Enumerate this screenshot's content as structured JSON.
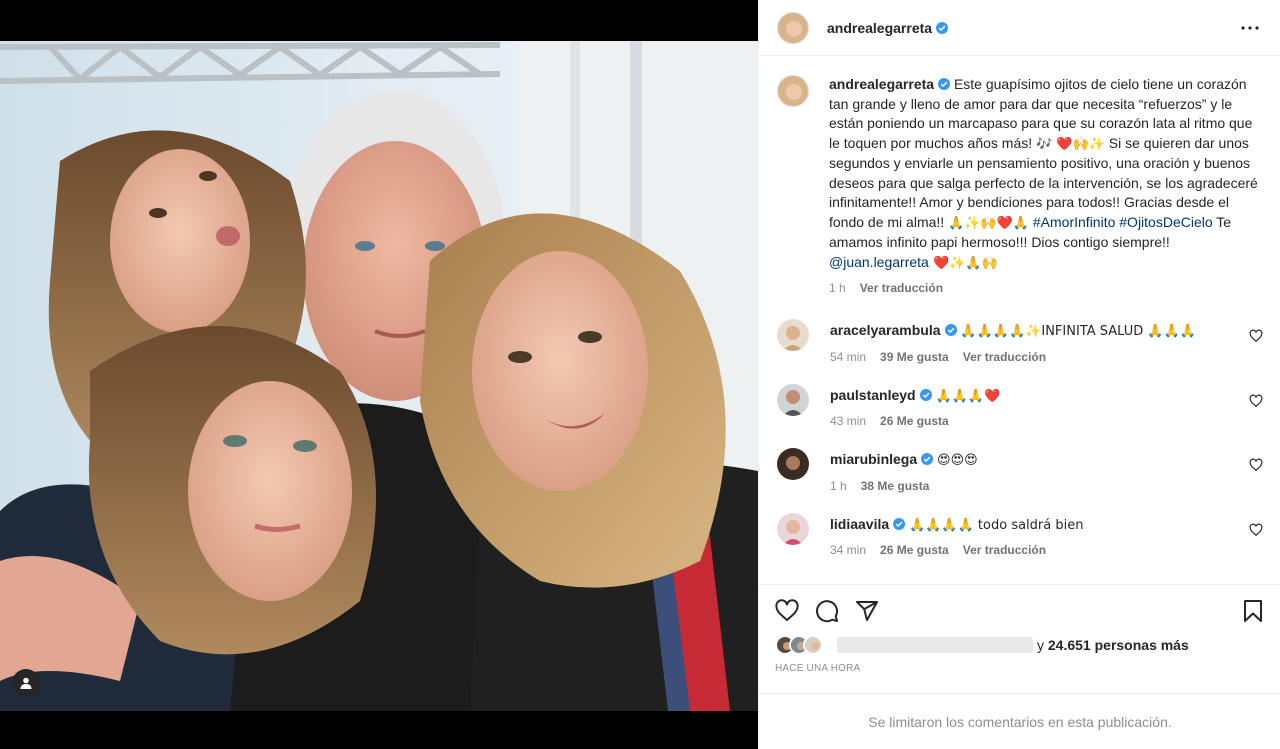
{
  "post": {
    "username": "andrealegarreta",
    "verified": true
  },
  "caption": {
    "username": "andrealegarreta",
    "text_1": "Este guapísimo ojitos de cielo tiene un corazón tan grande y lleno de amor para dar que necesita “refuerzos” y le están poniendo un marcapaso para que su corazón lata al ritmo que le toquen por muchos años más!",
    "emoji_1": "🎶 ❤️🙌✨",
    "text_2": " Si se quieren dar unos segundos y enviarle un pensamiento positivo, una oración y buenos deseos para que salga perfecto de la intervención, se los agradeceré infinitamente!! Amor y bendiciones para todos!! Gracias desde el fondo de mi alma!! ",
    "emoji_2": "🙏✨🙌❤️🙏",
    "hashtag_1": "#AmorInfinito",
    "hashtag_2": "#OjitosDeCielo",
    "text_3": " Te amamos infinito papi hermoso!!! Dios contigo siempre!! ",
    "mention": "@juan.legarreta",
    "emoji_3": " ❤️✨🙏🙌",
    "time": "1 h",
    "translate": "Ver traducción"
  },
  "comments": [
    {
      "username": "aracelyarambula",
      "text": "🙏🙏🙏🙏✨INFINITA SALUD 🙏🙏🙏",
      "time": "54 min",
      "likes": "39 Me gusta",
      "translate": "Ver traducción"
    },
    {
      "username": "paulstanleyd",
      "text": "🙏🙏🙏❤️",
      "time": "43 min",
      "likes": "26 Me gusta",
      "translate": ""
    },
    {
      "username": "miarubinlega",
      "text": "😍😍😍",
      "time": "1 h",
      "likes": "38 Me gusta",
      "translate": ""
    },
    {
      "username": "lidiaavila",
      "text": "🙏🙏🙏🙏 todo saldrá bien",
      "time": "34 min",
      "likes": "26 Me gusta",
      "translate": "Ver traducción"
    }
  ],
  "likes": {
    "suffix": "y ",
    "count": "24.651 personas más"
  },
  "posted_time": "HACE UNA HORA",
  "comments_limited": "Se limitaron los comentarios en esta publicación.",
  "colors": {
    "verified_blue": "#3897f0",
    "link": "#00376b",
    "muted": "#8e8e8e",
    "border": "#efefef"
  },
  "icons": [
    "more-icon",
    "heart-icon",
    "comment-icon",
    "share-icon",
    "bookmark-icon",
    "user-tag-icon",
    "verified-icon"
  ]
}
